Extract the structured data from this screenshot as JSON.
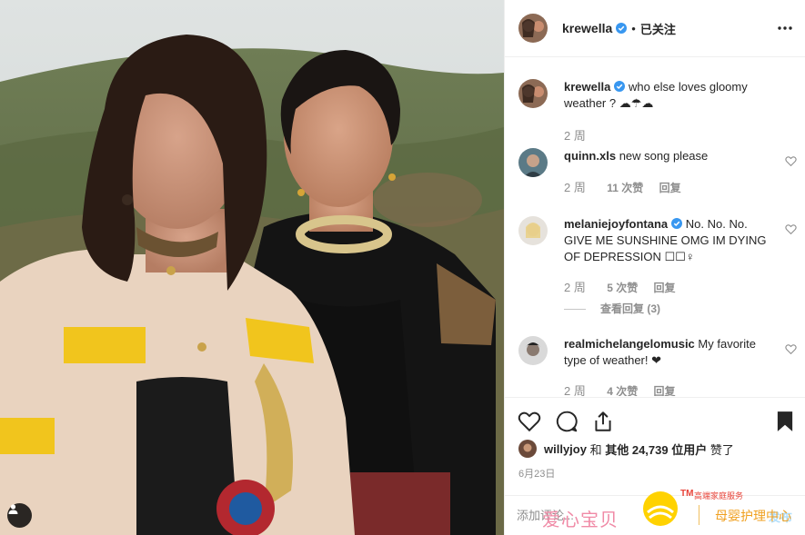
{
  "post": {
    "author": "krewella",
    "dot": "•",
    "follow_status": "已关注",
    "date": "6月23日",
    "colors": {
      "verified": "#3897f0",
      "accent": "#262626",
      "muted": "#8e8e8e"
    }
  },
  "caption": {
    "user": "krewella",
    "text": "who else loves gloomy weather ? ☁☂☁",
    "time": "2 周"
  },
  "comments": [
    {
      "user": "quinn.xls",
      "verified": false,
      "text": "new song please",
      "time": "2 周",
      "likes": "11 次赞",
      "reply": "回复"
    },
    {
      "user": "melaniejoyfontana",
      "verified": true,
      "text": "No. No. No. GIVE ME SUNSHINE OMG IM DYING OF DEPRESSION ☐☐♀",
      "time": "2 周",
      "likes": "5 次赞",
      "reply": "回复",
      "view_replies": "查看回复 (3)"
    },
    {
      "user": "realmichelangelomusic",
      "verified": false,
      "text": "My favorite type of weather! ❤",
      "time": "2 周",
      "likes": "4 次赞",
      "reply": "回复"
    }
  ],
  "likes": {
    "user": "willyjoy",
    "middle": "和",
    "others": "其他 24,739 位用户",
    "suffix": "赞了"
  },
  "add_comment": {
    "placeholder": "添加评论...",
    "post_label": "发布"
  },
  "icons": {
    "more": "more-horizontal-icon",
    "like": "heart-icon",
    "comment": "comment-bubble-icon",
    "share": "share-icon",
    "save": "bookmark-icon",
    "tag": "user-tag-icon",
    "verified": "verified-badge-icon"
  },
  "watermark": {
    "left": "爱心宝贝",
    "tm": "TM",
    "sub": "高端家庭服务",
    "right": "母婴护理中心"
  }
}
